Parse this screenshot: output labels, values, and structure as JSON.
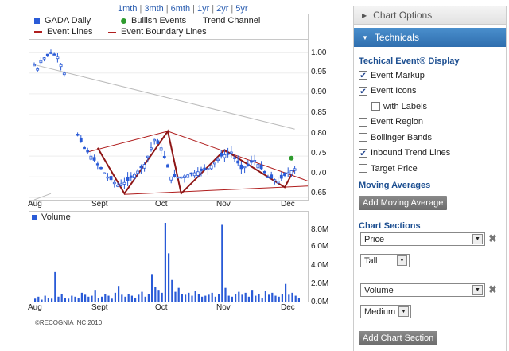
{
  "periods": [
    "1mth",
    "3mth",
    "6mth",
    "1yr",
    "2yr",
    "5yr"
  ],
  "legend": {
    "items": [
      {
        "label": "GADA Daily",
        "color": "#2a5bd7",
        "kind": "square"
      },
      {
        "label": "Bullish Events",
        "color": "#2e9b2e",
        "kind": "dot"
      },
      {
        "label": "Trend Channel",
        "color": "#bbbbbb",
        "kind": "line"
      },
      {
        "label": "Event Lines",
        "color": "#b01e1e",
        "kind": "line"
      },
      {
        "label": "Event Boundary Lines",
        "color": "#b01e1e",
        "kind": "line"
      }
    ]
  },
  "price_chart": {
    "y_ticks": [
      "1.00",
      "0.95",
      "0.90",
      "0.85",
      "0.80",
      "0.75",
      "0.70",
      "0.65"
    ],
    "x_ticks": [
      "Aug",
      "Sept",
      "Oct",
      "Nov",
      "Dec"
    ]
  },
  "volume_chart": {
    "label": "Volume",
    "y_ticks": [
      "8.0M",
      "6.0M",
      "4.0M",
      "2.0M",
      "0.0M"
    ],
    "x_ticks": [
      "Aug",
      "Sept",
      "Oct",
      "Nov",
      "Dec"
    ]
  },
  "copyright": "©RECOGNIA INC 2010",
  "sidebar": {
    "chart_options": "Chart Options",
    "technicals": "Technicals",
    "event_display_title": "Techical Event® Display",
    "options": [
      {
        "label": "Event Markup",
        "checked": true,
        "indent": false
      },
      {
        "label": "Event Icons",
        "checked": true,
        "indent": false
      },
      {
        "label": "with Labels",
        "checked": false,
        "indent": true
      },
      {
        "label": "Event Region",
        "checked": false,
        "indent": false
      },
      {
        "label": "Bollinger Bands",
        "checked": false,
        "indent": false
      },
      {
        "label": "Inbound Trend Lines",
        "checked": true,
        "indent": false
      },
      {
        "label": "Target Price",
        "checked": false,
        "indent": false
      }
    ],
    "moving_averages_title": "Moving Averages",
    "add_moving_average": "Add Moving Average",
    "chart_sections_title": "Chart Sections",
    "section1": {
      "type": "Price",
      "size": "Tall"
    },
    "section2": {
      "type": "Volume",
      "size": "Medium"
    },
    "add_chart_section": "Add Chart Section"
  },
  "chart_data": {
    "type": "candlestick",
    "title": "GADA Daily",
    "price_ylim": [
      0.645,
      1.03
    ],
    "volume_ylim": [
      0,
      8.0
    ],
    "x_range": [
      "Aug",
      "Dec"
    ],
    "price_series": [
      {
        "day": 0,
        "close": 0.97
      },
      {
        "day": 1,
        "close": 0.96
      },
      {
        "day": 2,
        "close": 0.98
      },
      {
        "day": 5,
        "close": 1.0
      },
      {
        "day": 7,
        "close": 0.99
      },
      {
        "day": 9,
        "close": 0.95
      },
      {
        "day": 13,
        "close": 0.8
      },
      {
        "day": 15,
        "close": 0.77
      },
      {
        "day": 18,
        "close": 0.74
      },
      {
        "day": 22,
        "close": 0.7
      },
      {
        "day": 25,
        "close": 0.68
      },
      {
        "day": 28,
        "close": 0.69
      },
      {
        "day": 33,
        "close": 0.73
      },
      {
        "day": 36,
        "close": 0.79
      },
      {
        "day": 38,
        "close": 0.77
      },
      {
        "day": 41,
        "close": 0.7
      },
      {
        "day": 44,
        "close": 0.7
      },
      {
        "day": 48,
        "close": 0.71
      },
      {
        "day": 52,
        "close": 0.72
      },
      {
        "day": 56,
        "close": 0.75
      },
      {
        "day": 59,
        "close": 0.76
      },
      {
        "day": 62,
        "close": 0.72
      },
      {
        "day": 66,
        "close": 0.74
      },
      {
        "day": 70,
        "close": 0.7
      },
      {
        "day": 73,
        "close": 0.69
      },
      {
        "day": 76,
        "close": 0.71
      },
      {
        "day": 78,
        "close": 0.72
      }
    ],
    "volume_series_M": [
      0.3,
      0.5,
      0.2,
      0.6,
      0.4,
      0.3,
      3.0,
      0.5,
      0.8,
      0.4,
      0.3,
      0.6,
      0.5,
      0.4,
      0.9,
      0.7,
      0.5,
      0.6,
      1.2,
      0.4,
      0.5,
      0.8,
      0.6,
      0.3,
      0.9,
      1.6,
      0.7,
      0.5,
      0.8,
      0.6,
      0.4,
      0.7,
      1.0,
      0.5,
      0.8,
      2.8,
      1.5,
      1.2,
      0.9,
      8.8,
      4.9,
      2.2,
      1.0,
      1.4,
      0.8,
      0.7,
      0.9,
      0.6,
      1.1,
      0.8,
      0.5,
      0.6,
      0.7,
      0.9,
      0.5,
      0.8,
      7.8,
      1.4,
      0.6,
      0.5,
      0.8,
      1.0,
      0.7,
      0.9,
      0.5,
      1.2,
      0.6,
      0.8,
      0.4,
      1.1,
      0.7,
      0.9,
      0.6,
      0.5,
      0.8,
      1.8,
      0.7,
      0.9,
      0.6,
      0.4
    ],
    "bullish_event": {
      "day": 77,
      "price": 0.745
    }
  }
}
